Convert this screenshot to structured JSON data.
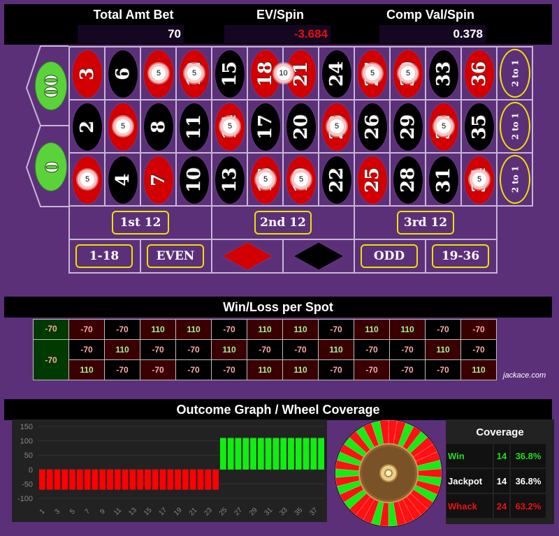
{
  "header": {
    "total_amt_bet_label": "Total Amt Bet",
    "total_amt_bet": "70",
    "ev_spin_label": "EV/Spin",
    "ev_spin": "-3.684",
    "comp_val_label": "Comp Val/Spin",
    "comp_val": "0.378"
  },
  "table": {
    "zeros": [
      "00",
      "0"
    ],
    "rows": [
      [
        3,
        6,
        9,
        12,
        15,
        18,
        21,
        24,
        27,
        30,
        33,
        36
      ],
      [
        2,
        5,
        8,
        11,
        14,
        17,
        20,
        23,
        26,
        29,
        32,
        35
      ],
      [
        1,
        4,
        7,
        10,
        13,
        16,
        19,
        22,
        25,
        28,
        31,
        34
      ]
    ],
    "red_numbers": [
      1,
      3,
      5,
      7,
      9,
      12,
      14,
      16,
      18,
      19,
      21,
      23,
      25,
      27,
      30,
      32,
      34,
      36
    ],
    "column_bets": [
      "2 to 1",
      "2 to 1",
      "2 to 1"
    ],
    "dozens": [
      "1st 12",
      "2nd 12",
      "3rd 12"
    ],
    "even_money": [
      "1-18",
      "EVEN",
      "red-diamond",
      "black-diamond",
      "ODD",
      "19-36"
    ],
    "chips": [
      {
        "on": "9",
        "amount": "5"
      },
      {
        "on": "12",
        "amount": "5"
      },
      {
        "on": "18-21 split",
        "amount": "10"
      },
      {
        "on": "27",
        "amount": "5"
      },
      {
        "on": "30",
        "amount": "5"
      },
      {
        "on": "5",
        "amount": "5"
      },
      {
        "on": "14",
        "amount": "5"
      },
      {
        "on": "23",
        "amount": "5"
      },
      {
        "on": "32",
        "amount": "5"
      },
      {
        "on": "1",
        "amount": "5"
      },
      {
        "on": "16",
        "amount": "5"
      },
      {
        "on": "19",
        "amount": "5"
      },
      {
        "on": "34",
        "amount": "5"
      }
    ]
  },
  "winloss": {
    "title": "Win/Loss per Spot",
    "zeros": [
      "-70",
      "-70"
    ],
    "rows": [
      [
        "-70",
        "-70",
        "110",
        "110",
        "-70",
        "110",
        "110",
        "-70",
        "110",
        "110",
        "-70",
        "-70"
      ],
      [
        "-70",
        "110",
        "-70",
        "-70",
        "110",
        "-70",
        "-70",
        "110",
        "-70",
        "-70",
        "110",
        "-70"
      ],
      [
        "110",
        "-70",
        "-70",
        "-70",
        "-70",
        "110",
        "110",
        "-70",
        "-70",
        "-70",
        "-70",
        "110"
      ]
    ],
    "brand": "jackace.com"
  },
  "outcome": {
    "title": "Outcome Graph / Wheel Coverage"
  },
  "chart_data": {
    "type": "bar",
    "title": "Outcome Graph",
    "x": [
      1,
      2,
      3,
      4,
      5,
      6,
      7,
      8,
      9,
      10,
      11,
      12,
      13,
      14,
      15,
      16,
      17,
      18,
      19,
      20,
      21,
      22,
      23,
      24,
      25,
      26,
      27,
      28,
      29,
      30,
      31,
      32,
      33,
      34,
      35,
      36,
      37,
      38
    ],
    "x_tick_labels": [
      "1",
      "3",
      "5",
      "7",
      "9",
      "11",
      "13",
      "15",
      "17",
      "19",
      "21",
      "23",
      "25",
      "27",
      "29",
      "31",
      "33",
      "35",
      "37"
    ],
    "values": [
      -70,
      -70,
      -70,
      -70,
      -70,
      -70,
      -70,
      -70,
      -70,
      -70,
      -70,
      -70,
      -70,
      -70,
      -70,
      -70,
      -70,
      -70,
      -70,
      -70,
      -70,
      -70,
      -70,
      -70,
      110,
      110,
      110,
      110,
      110,
      110,
      110,
      110,
      110,
      110,
      110,
      110,
      110,
      110
    ],
    "y_ticks": [
      150,
      100,
      50,
      0,
      -50,
      -100
    ],
    "ylim": [
      -100,
      150
    ],
    "colors": {
      "positive": "#11ee11",
      "negative": "#ff0000"
    },
    "grid": true
  },
  "coverage": {
    "title": "Coverage",
    "rows": [
      {
        "label": "Win",
        "count": "14",
        "pct": "36.8%",
        "color": "#22dd22"
      },
      {
        "label": "Jackpot",
        "count": "14",
        "pct": "36.8%",
        "color": "#ffffff"
      },
      {
        "label": "Whack",
        "count": "24",
        "pct": "63.2%",
        "color": "#ee1111"
      }
    ]
  }
}
